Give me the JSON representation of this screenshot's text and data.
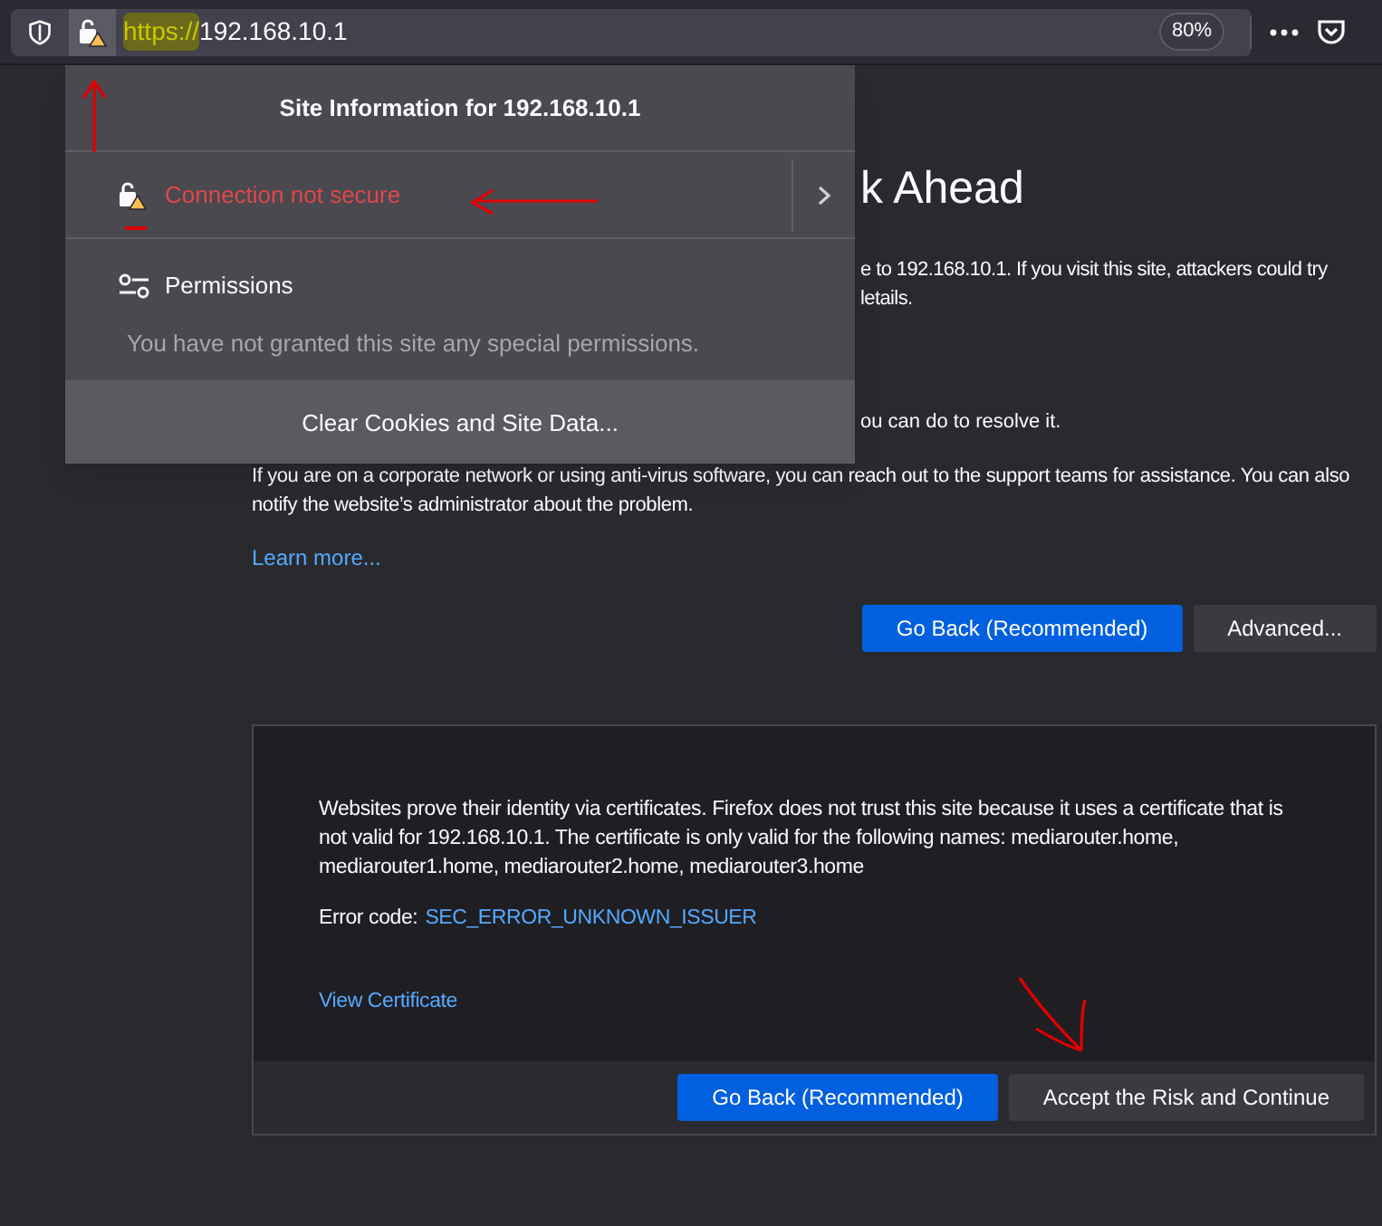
{
  "toolbar": {
    "url": {
      "scheme": "https://",
      "host": "192.168.10.1"
    },
    "zoom": "80%"
  },
  "site_info_popup": {
    "title": "Site Information for 192.168.10.1",
    "connection": {
      "label": "Connection not secure",
      "secure": false
    },
    "permissions": {
      "title": "Permissions",
      "note": "You have not granted this site any special permissions."
    },
    "clear_button": "Clear Cookies and Site Data..."
  },
  "error_page": {
    "heading_fragment": "k Ahead",
    "intro_fragments": [
      "e to 192.168.10.1. If you visit this site, attackers could try",
      "letails."
    ],
    "resolve_fragment": "ou can do to resolve it.",
    "paragraph": "If you are on a corporate network or using anti-virus software, you can reach out to the support teams for assistance. You can also notify the website’s administrator about the problem.",
    "learn_more": "Learn more...",
    "buttons": [
      {
        "label": "Go Back (Recommended)",
        "primary": true
      },
      {
        "label": "Advanced...",
        "primary": false
      }
    ]
  },
  "advanced_panel": {
    "description": "Websites prove their identity via certificates. Firefox does not trust this site because it uses a certificate that is not valid for 192.168.10.1. The certificate is only valid for the following names: mediarouter.home, mediarouter1.home, mediarouter2.home, mediarouter3.home",
    "error_label": "Error code:",
    "error_code": "SEC_ERROR_UNKNOWN_ISSUER",
    "view_certificate": "View Certificate",
    "buttons": [
      {
        "label": "Go Back (Recommended)",
        "primary": true
      },
      {
        "label": "Accept the Risk and Continue",
        "primary": false
      }
    ]
  }
}
